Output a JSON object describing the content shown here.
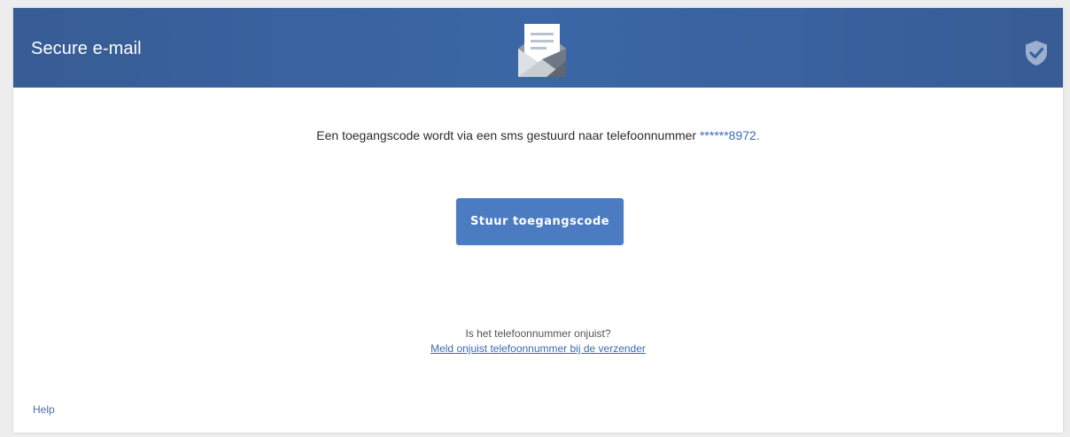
{
  "header": {
    "title": "Secure e-mail",
    "center_icon": "envelope-open-letter-icon",
    "right_icon": "shield-check-icon"
  },
  "message": {
    "text": "Een toegangscode wordt via een sms gestuurd naar telefoonnummer ",
    "phone": "******8972",
    "suffix": "."
  },
  "actions": {
    "send_code_label": "Stuur toegangscode"
  },
  "wrong_number": {
    "question": "Is het telefoonnummer onjuist?",
    "link_label": "Meld onjuist telefoonnummer bij de verzender"
  },
  "footer": {
    "help_label": "Help"
  },
  "colors": {
    "header_bg": "#3a62a0",
    "button_bg": "#4b7cc1",
    "link": "#3b6cb3"
  }
}
